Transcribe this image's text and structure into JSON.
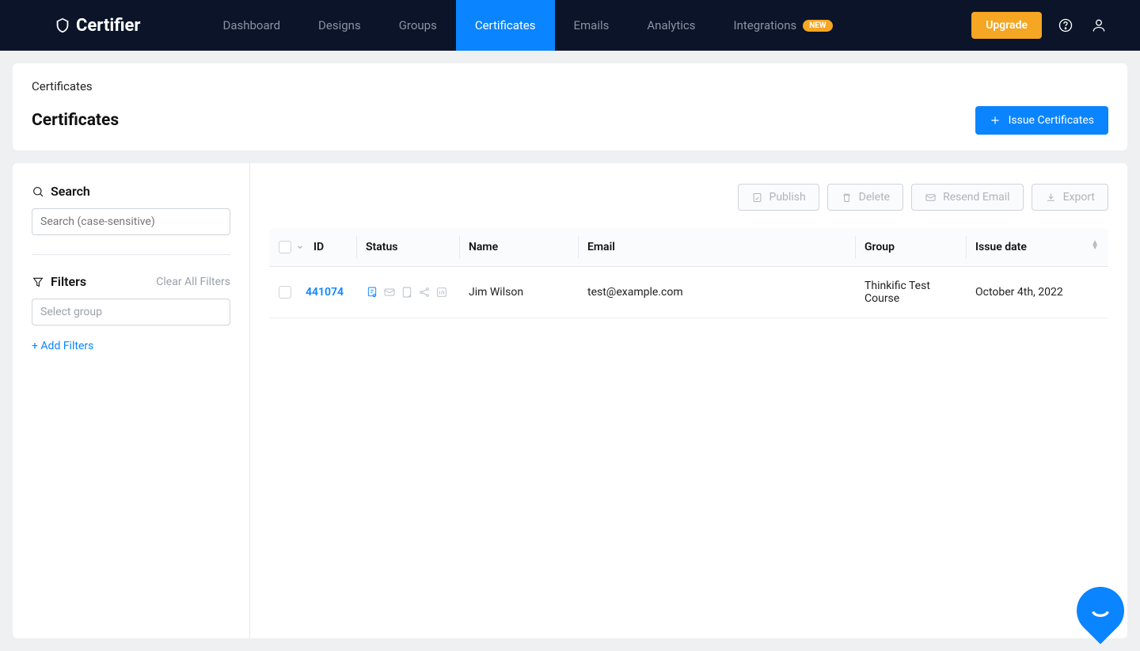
{
  "brand": "Certifier",
  "nav": {
    "items": [
      {
        "label": "Dashboard"
      },
      {
        "label": "Designs"
      },
      {
        "label": "Groups"
      },
      {
        "label": "Certificates",
        "active": true
      },
      {
        "label": "Emails"
      },
      {
        "label": "Analytics"
      },
      {
        "label": "Integrations",
        "badge": "NEW"
      }
    ],
    "upgrade": "Upgrade"
  },
  "breadcrumb": "Certificates",
  "page_title": "Certificates",
  "issue_button": "Issue Certificates",
  "sidebar": {
    "search_title": "Search",
    "search_placeholder": "Search (case-sensitive)",
    "filters_title": "Filters",
    "clear_filters": "Clear All Filters",
    "group_placeholder": "Select group",
    "add_filters": "+ Add Filters"
  },
  "actions": {
    "publish": "Publish",
    "delete": "Delete",
    "resend": "Resend Email",
    "export": "Export"
  },
  "table": {
    "headers": {
      "id": "ID",
      "status": "Status",
      "name": "Name",
      "email": "Email",
      "group": "Group",
      "issue_date": "Issue date"
    },
    "rows": [
      {
        "id": "441074",
        "name": "Jim Wilson",
        "email": "test@example.com",
        "group": "Thinkific Test Course",
        "issue_date": "October 4th, 2022"
      }
    ]
  }
}
